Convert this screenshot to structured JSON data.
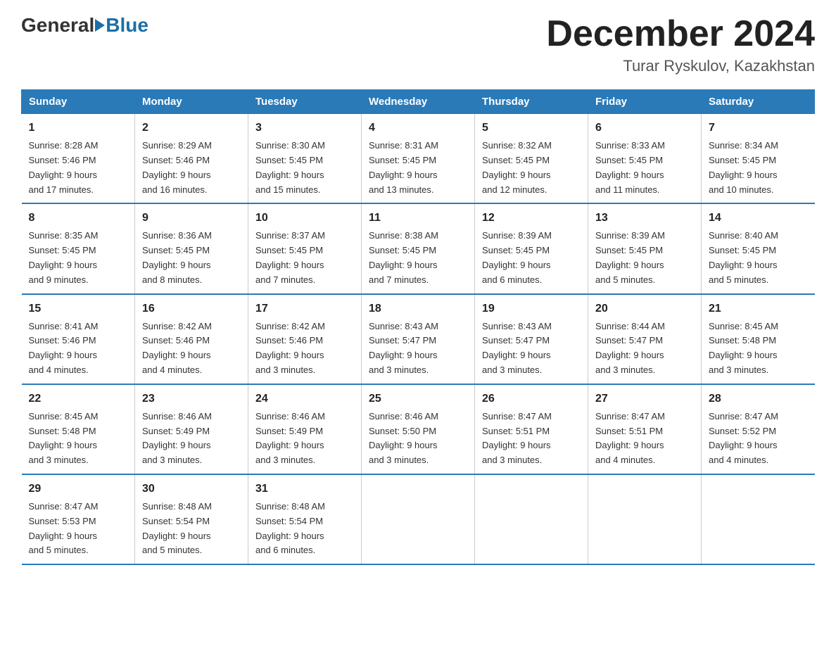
{
  "header": {
    "logo_general": "General",
    "logo_blue": "Blue",
    "month_title": "December 2024",
    "location": "Turar Ryskulov, Kazakhstan"
  },
  "weekdays": [
    "Sunday",
    "Monday",
    "Tuesday",
    "Wednesday",
    "Thursday",
    "Friday",
    "Saturday"
  ],
  "weeks": [
    [
      {
        "day": "1",
        "sunrise": "8:28 AM",
        "sunset": "5:46 PM",
        "daylight": "9 hours and 17 minutes."
      },
      {
        "day": "2",
        "sunrise": "8:29 AM",
        "sunset": "5:46 PM",
        "daylight": "9 hours and 16 minutes."
      },
      {
        "day": "3",
        "sunrise": "8:30 AM",
        "sunset": "5:45 PM",
        "daylight": "9 hours and 15 minutes."
      },
      {
        "day": "4",
        "sunrise": "8:31 AM",
        "sunset": "5:45 PM",
        "daylight": "9 hours and 13 minutes."
      },
      {
        "day": "5",
        "sunrise": "8:32 AM",
        "sunset": "5:45 PM",
        "daylight": "9 hours and 12 minutes."
      },
      {
        "day": "6",
        "sunrise": "8:33 AM",
        "sunset": "5:45 PM",
        "daylight": "9 hours and 11 minutes."
      },
      {
        "day": "7",
        "sunrise": "8:34 AM",
        "sunset": "5:45 PM",
        "daylight": "9 hours and 10 minutes."
      }
    ],
    [
      {
        "day": "8",
        "sunrise": "8:35 AM",
        "sunset": "5:45 PM",
        "daylight": "9 hours and 9 minutes."
      },
      {
        "day": "9",
        "sunrise": "8:36 AM",
        "sunset": "5:45 PM",
        "daylight": "9 hours and 8 minutes."
      },
      {
        "day": "10",
        "sunrise": "8:37 AM",
        "sunset": "5:45 PM",
        "daylight": "9 hours and 7 minutes."
      },
      {
        "day": "11",
        "sunrise": "8:38 AM",
        "sunset": "5:45 PM",
        "daylight": "9 hours and 7 minutes."
      },
      {
        "day": "12",
        "sunrise": "8:39 AM",
        "sunset": "5:45 PM",
        "daylight": "9 hours and 6 minutes."
      },
      {
        "day": "13",
        "sunrise": "8:39 AM",
        "sunset": "5:45 PM",
        "daylight": "9 hours and 5 minutes."
      },
      {
        "day": "14",
        "sunrise": "8:40 AM",
        "sunset": "5:45 PM",
        "daylight": "9 hours and 5 minutes."
      }
    ],
    [
      {
        "day": "15",
        "sunrise": "8:41 AM",
        "sunset": "5:46 PM",
        "daylight": "9 hours and 4 minutes."
      },
      {
        "day": "16",
        "sunrise": "8:42 AM",
        "sunset": "5:46 PM",
        "daylight": "9 hours and 4 minutes."
      },
      {
        "day": "17",
        "sunrise": "8:42 AM",
        "sunset": "5:46 PM",
        "daylight": "9 hours and 3 minutes."
      },
      {
        "day": "18",
        "sunrise": "8:43 AM",
        "sunset": "5:47 PM",
        "daylight": "9 hours and 3 minutes."
      },
      {
        "day": "19",
        "sunrise": "8:43 AM",
        "sunset": "5:47 PM",
        "daylight": "9 hours and 3 minutes."
      },
      {
        "day": "20",
        "sunrise": "8:44 AM",
        "sunset": "5:47 PM",
        "daylight": "9 hours and 3 minutes."
      },
      {
        "day": "21",
        "sunrise": "8:45 AM",
        "sunset": "5:48 PM",
        "daylight": "9 hours and 3 minutes."
      }
    ],
    [
      {
        "day": "22",
        "sunrise": "8:45 AM",
        "sunset": "5:48 PM",
        "daylight": "9 hours and 3 minutes."
      },
      {
        "day": "23",
        "sunrise": "8:46 AM",
        "sunset": "5:49 PM",
        "daylight": "9 hours and 3 minutes."
      },
      {
        "day": "24",
        "sunrise": "8:46 AM",
        "sunset": "5:49 PM",
        "daylight": "9 hours and 3 minutes."
      },
      {
        "day": "25",
        "sunrise": "8:46 AM",
        "sunset": "5:50 PM",
        "daylight": "9 hours and 3 minutes."
      },
      {
        "day": "26",
        "sunrise": "8:47 AM",
        "sunset": "5:51 PM",
        "daylight": "9 hours and 3 minutes."
      },
      {
        "day": "27",
        "sunrise": "8:47 AM",
        "sunset": "5:51 PM",
        "daylight": "9 hours and 4 minutes."
      },
      {
        "day": "28",
        "sunrise": "8:47 AM",
        "sunset": "5:52 PM",
        "daylight": "9 hours and 4 minutes."
      }
    ],
    [
      {
        "day": "29",
        "sunrise": "8:47 AM",
        "sunset": "5:53 PM",
        "daylight": "9 hours and 5 minutes."
      },
      {
        "day": "30",
        "sunrise": "8:48 AM",
        "sunset": "5:54 PM",
        "daylight": "9 hours and 5 minutes."
      },
      {
        "day": "31",
        "sunrise": "8:48 AM",
        "sunset": "5:54 PM",
        "daylight": "9 hours and 6 minutes."
      },
      null,
      null,
      null,
      null
    ]
  ],
  "labels": {
    "sunrise": "Sunrise:",
    "sunset": "Sunset:",
    "daylight": "Daylight:"
  }
}
